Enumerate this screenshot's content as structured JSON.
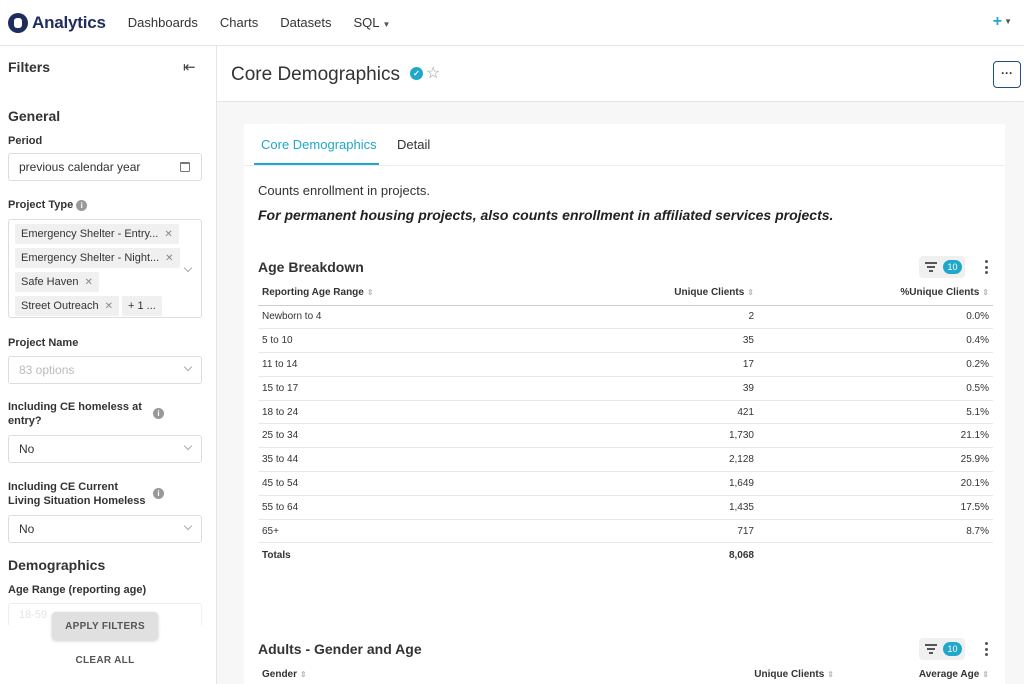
{
  "nav": {
    "logo": "Analytics",
    "items": [
      "Dashboards",
      "Charts",
      "Datasets",
      "SQL"
    ],
    "plus": "+"
  },
  "sidebar": {
    "title": "Filters",
    "general_heading": "General",
    "period_label": "Period",
    "period_value": "previous calendar year",
    "project_type_label": "Project Type",
    "project_type_tags": [
      "Emergency Shelter - Entry...",
      "Emergency Shelter - Night...",
      "Safe Haven",
      "Street Outreach"
    ],
    "project_type_more": "+ 1 ...",
    "project_name_label": "Project Name",
    "project_name_placeholder": "83 options",
    "ce_homeless_label": "Including CE homeless at entry?",
    "ce_homeless_value": "No",
    "ce_current_label": "Including CE Current Living Situation Homeless",
    "ce_current_value": "No",
    "demographics_heading": "Demographics",
    "age_range_label": "Age Range (reporting age)",
    "age_range_faded": "18-59",
    "apply_label": "APPLY FILTERS",
    "clear_label": "CLEAR ALL"
  },
  "header": {
    "title": "Core Demographics",
    "more": "···"
  },
  "tabs": [
    "Core Demographics",
    "Detail"
  ],
  "description": {
    "line1": "Counts enrollment in projects.",
    "line2": "For permanent housing projects, also counts enrollment in affiliated services projects."
  },
  "age_table": {
    "title": "Age Breakdown",
    "filter_count": "10",
    "columns": [
      "Reporting Age Range",
      "Unique Clients",
      "%Unique Clients"
    ],
    "rows": [
      [
        "Newborn to 4",
        "2",
        "0.0%"
      ],
      [
        "5 to 10",
        "35",
        "0.4%"
      ],
      [
        "11 to 14",
        "17",
        "0.2%"
      ],
      [
        "15 to 17",
        "39",
        "0.5%"
      ],
      [
        "18 to 24",
        "421",
        "5.1%"
      ],
      [
        "25 to 34",
        "1,730",
        "21.1%"
      ],
      [
        "35 to 44",
        "2,128",
        "25.9%"
      ],
      [
        "45 to 54",
        "1,649",
        "20.1%"
      ],
      [
        "55 to 64",
        "1,435",
        "17.5%"
      ],
      [
        "65+",
        "717",
        "8.7%"
      ]
    ],
    "totals_label": "Totals",
    "totals_value": "8,068"
  },
  "gender_table": {
    "title": "Adults - Gender and Age",
    "filter_count": "10",
    "columns": [
      "Gender",
      "Unique Clients",
      "Average Age"
    ]
  },
  "colors": {
    "accent": "#20a7c9",
    "brand": "#1f2d5c"
  }
}
